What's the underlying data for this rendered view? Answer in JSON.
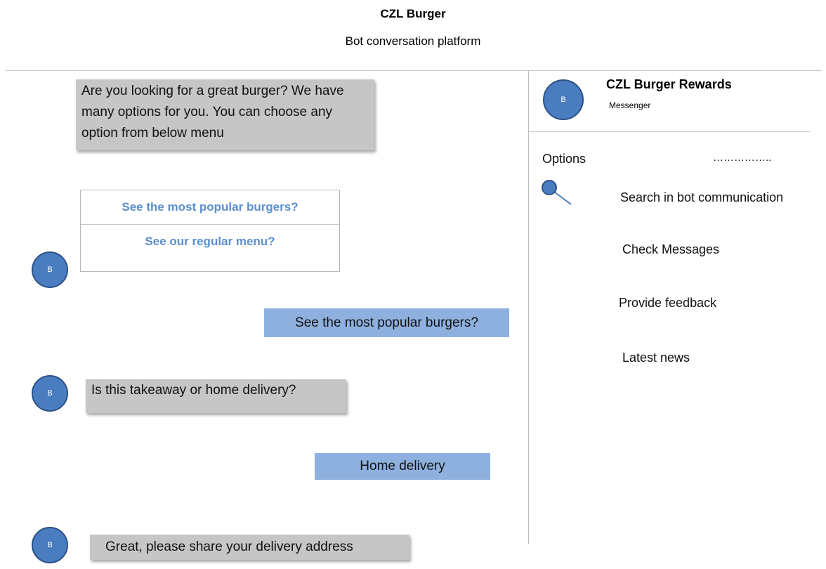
{
  "header": {
    "title": "CZL Burger",
    "subtitle": "Bot conversation platform"
  },
  "chat": {
    "bot_avatar_letter": "B",
    "intro_message": "Are you looking for a great burger? We have many options for you. You can choose any option from below menu",
    "menu_options": [
      "See the most popular burgers?",
      "See our regular menu?"
    ],
    "user_reply_1": "See the most popular burgers?",
    "bot_question": "Is this takeaway or home delivery?",
    "user_reply_2": "Home delivery",
    "bot_request": "Great, please share your delivery address"
  },
  "sidebar": {
    "avatar_letter": "B",
    "contact_name": "CZL Burger Rewards",
    "contact_sub": "Messenger",
    "options_label": "Options",
    "options_more": "……………..",
    "items": [
      "Search in bot communication",
      "Check Messages",
      "Provide feedback",
      "Latest news"
    ]
  },
  "colors": {
    "avatar": "#4a7dc0",
    "bot_bubble": "#c6c6c6",
    "user_bubble": "#8eb0de",
    "menu_link": "#5b8fcf"
  },
  "icons": {
    "search": "search-icon"
  }
}
